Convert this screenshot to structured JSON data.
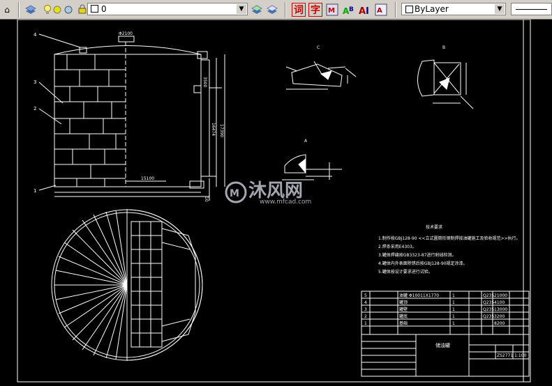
{
  "toolbar": {
    "layer_name": "0",
    "color_value": "ByLayer",
    "text_btn_1": "词",
    "text_btn_2": "字"
  },
  "drawing": {
    "watermark_cn": "沐风网",
    "watermark_url": "www.mfcad.com",
    "callouts": [
      "4",
      "3",
      "2",
      "1"
    ],
    "detail_labels": [
      "C",
      "B",
      "A"
    ],
    "dim_top": "Φ2100",
    "dim_bottom": "15100",
    "dim_height_1": "3500",
    "dim_height_2": "16474",
    "dim_height_3": "17390",
    "dim_base": "10",
    "notes_title": "技术要求",
    "notes": [
      "1.制作按GBJ128-90 <<立式圆筒形钢制焊接油罐施工及验收规范>>执行。",
      "2.焊条采用E4303。",
      "3.罐体焊缝按GB3323-87进行射线检测。",
      "4.罐体内外表面除锈后按GBJ128-90规定涂漆。",
      "5.罐体按设计要求进行试验。"
    ],
    "table_rows": [
      {
        "no": "5",
        "code": "",
        "name": "油罐 Φ10011X1770",
        "qty": "1",
        "mat": "Q235",
        "wt": "21000"
      },
      {
        "no": "4",
        "code": "",
        "name": "罐顶",
        "qty": "1",
        "mat": "Q235",
        "wt": "4100"
      },
      {
        "no": "3",
        "code": "",
        "name": "罐壁",
        "qty": "1",
        "mat": "Q235",
        "wt": "13000"
      },
      {
        "no": "2",
        "code": "",
        "name": "罐底",
        "qty": "1",
        "mat": "Q235",
        "wt": "3200"
      },
      {
        "no": "1",
        "code": "",
        "name": "基础",
        "qty": "1",
        "mat": "",
        "wt": "8200"
      }
    ],
    "title_block": {
      "drawing_name": "储油罐",
      "scale": "1:100",
      "drawing_no": "ZS2771"
    }
  }
}
